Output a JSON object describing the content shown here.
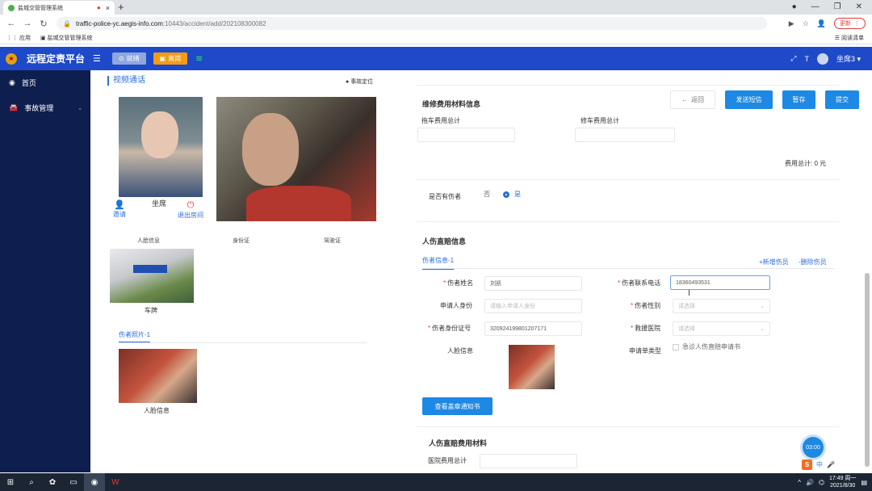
{
  "browser": {
    "tab_title": "盐城交管管理系统",
    "new_tab": "+",
    "url_host": "traffic-police-yc.aegis-info.com",
    "url_path": ":10443/accident/add/202108300082",
    "update_label": "更新",
    "bookmarks": [
      "应用",
      "盐城交管管理系统"
    ],
    "reading_list": "阅读清单"
  },
  "app": {
    "title": "远程定责平台",
    "status_ready": "就绪",
    "status_busy": "离岗",
    "user": "坐席3"
  },
  "sidebar": {
    "items": [
      {
        "label": "首页",
        "icon": "dashboard-icon"
      },
      {
        "label": "事故管理",
        "icon": "car-icon"
      }
    ]
  },
  "video": {
    "title": "视频通话",
    "locate": "事故定位",
    "agent_label": "坐席",
    "invite": "邀请",
    "leave": "退出房间",
    "captions": [
      "人脸信息",
      "身份证",
      "驾驶证"
    ],
    "plate_caption": "车牌",
    "injured_tab": "伤者照片-1",
    "face_caption": "人脸信息"
  },
  "form": {
    "section_repair": "维修费用材料信息",
    "back": "返回",
    "send_sms": "发送短信",
    "save_draft": "暂存",
    "submit": "提交",
    "tow_fee_label": "拖车费用总计",
    "repair_fee_label": "修车费用总计",
    "total_fee": "费用总计: 0 元",
    "has_injury_label": "是否有伤者",
    "option_no": "否",
    "option_yes": "是",
    "section_injury": "人伤直赔信息",
    "injured_tab": "伤者信息-1",
    "add_injured": "+新增伤员",
    "delete_injured": "-删除伤员",
    "name_label": "伤者姓名",
    "name_value": "刘凯",
    "phone_label": "伤者联系电话",
    "phone_value": "18360493531",
    "applicant_id_label": "申请人身份",
    "applicant_id_placeholder": "请输入申请人身份",
    "gender_label": "伤者性别",
    "gender_placeholder": "请选择",
    "id_number_label": "伤者身份证号",
    "id_number_value": "320924199801207171",
    "hospital_label": "救援医院",
    "hospital_placeholder": "请选择",
    "face_label": "人脸信息",
    "apply_type_label": "申请单类型",
    "apply_type_option": "急诊人伤直赔申请书",
    "view_notice": "查看盖章通知书",
    "section_injury_fee": "人伤直赔费用材料",
    "hospital_fee_label": "医院费用总计"
  },
  "timer": "03:00",
  "taskbar": {
    "time": "17:49 周一",
    "date": "2021/8/30",
    "ime": "中"
  }
}
